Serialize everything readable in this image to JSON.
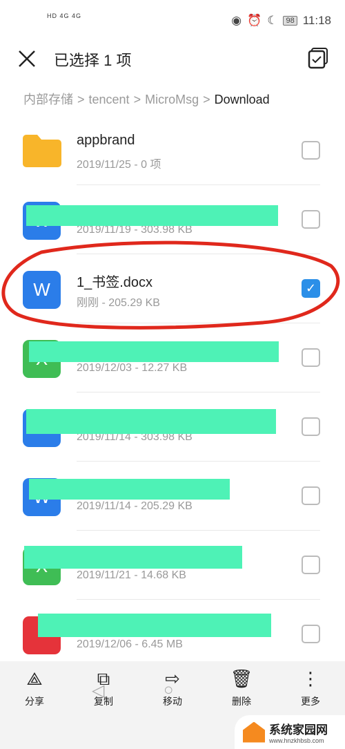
{
  "status_bar": {
    "left": "HD 4G 4G",
    "time": "11:18",
    "battery": "98"
  },
  "header": {
    "title": "已选择 1 项",
    "close_icon": "close-icon",
    "select_all_icon": "select-all-icon"
  },
  "breadcrumb": [
    "内部存储",
    "tencent",
    "MicroMsg",
    "Download"
  ],
  "files": [
    {
      "name": "appbrand",
      "meta": "2019/11/25 - 0 项",
      "type": "folder",
      "color": "#f8b52a",
      "glyph": "",
      "checked": false,
      "redacted": false
    },
    {
      "name": "",
      "meta": "2019/11/19 - 303.98 KB",
      "type": "word",
      "color": "#2b7de9",
      "glyph": "W",
      "checked": false,
      "redacted": true
    },
    {
      "name": "1_书签.docx",
      "meta": "刚刚 - 205.29 KB",
      "type": "word",
      "color": "#2b7de9",
      "glyph": "W",
      "checked": true,
      "redacted": false
    },
    {
      "name": "",
      "meta": "2019/12/03 - 12.27 KB",
      "type": "excel",
      "color": "#3fbd55",
      "glyph": "X",
      "checked": false,
      "redacted": true
    },
    {
      "name": "",
      "meta": "2019/11/14 - 303.98 KB",
      "type": "word",
      "color": "#2b7de9",
      "glyph": "W",
      "checked": false,
      "redacted": true
    },
    {
      "name": "",
      "meta": "2019/11/14 - 205.29 KB",
      "type": "word",
      "color": "#2b7de9",
      "glyph": "W",
      "checked": false,
      "redacted": true
    },
    {
      "name": "",
      "meta": "2019/11/21 - 14.68 KB",
      "type": "excel",
      "color": "#3fbd55",
      "glyph": "X",
      "checked": false,
      "redacted": true
    },
    {
      "name": "",
      "meta": "2019/12/06 - 6.45 MB",
      "type": "pdf",
      "color": "#e5333a",
      "glyph": "",
      "checked": false,
      "redacted": true
    }
  ],
  "toolbar": [
    {
      "label": "分享",
      "icon": "share-icon",
      "glyph": "⟁"
    },
    {
      "label": "复制",
      "icon": "copy-icon",
      "glyph": "⧉"
    },
    {
      "label": "移动",
      "icon": "move-icon",
      "glyph": "⇨"
    },
    {
      "label": "删除",
      "icon": "delete-icon",
      "glyph": "🗑"
    },
    {
      "label": "更多",
      "icon": "more-icon",
      "glyph": "⋮"
    }
  ],
  "watermark": {
    "name": "系统家园网",
    "url": "www.hnzkhbsb.com"
  }
}
